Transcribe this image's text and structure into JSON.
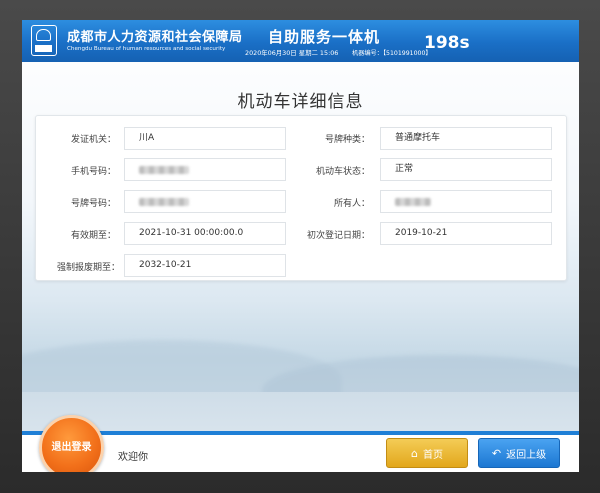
{
  "header": {
    "org_name": "成都市人力资源和社会保障局",
    "org_name_en": "Chengdu Bureau of human resources and social security",
    "service_title": "自助服务一体机",
    "datetime": "2020年06月30日 星期二 15:06",
    "machine_label": "机器编号：",
    "machine_no": "【5101991000】",
    "countdown": "198s"
  },
  "page": {
    "title": "机动车详细信息"
  },
  "fields": {
    "issuing_authority": {
      "label": "发证机关：",
      "value": "川A"
    },
    "plate_type": {
      "label": "号牌种类：",
      "value": "普通摩托车"
    },
    "phone": {
      "label": "手机号码：",
      "value": ""
    },
    "vehicle_status": {
      "label": "机动车状态：",
      "value": "正常"
    },
    "plate_no": {
      "label": "号牌号码：",
      "value": ""
    },
    "owner": {
      "label": "所有人：",
      "value": ""
    },
    "valid_until": {
      "label": "有效期至：",
      "value": "2021-10-31 00:00:00.0"
    },
    "first_reg_date": {
      "label": "初次登记日期：",
      "value": "2019-10-21"
    },
    "scrap_deadline": {
      "label": "强制报废期至：",
      "value": "2032-10-21"
    }
  },
  "footer": {
    "logout_label": "退出登录",
    "welcome": "欢迎你",
    "home_label": "首页",
    "back_label": "返回上级"
  },
  "icons": {
    "logo": "bureau-logo-icon",
    "home": "home-icon",
    "back": "back-arrow-icon"
  },
  "colors": {
    "header_blue": "#1a6fc6",
    "logout_orange": "#f2701a",
    "home_gold": "#e2a71c",
    "back_blue": "#1c77d2"
  }
}
